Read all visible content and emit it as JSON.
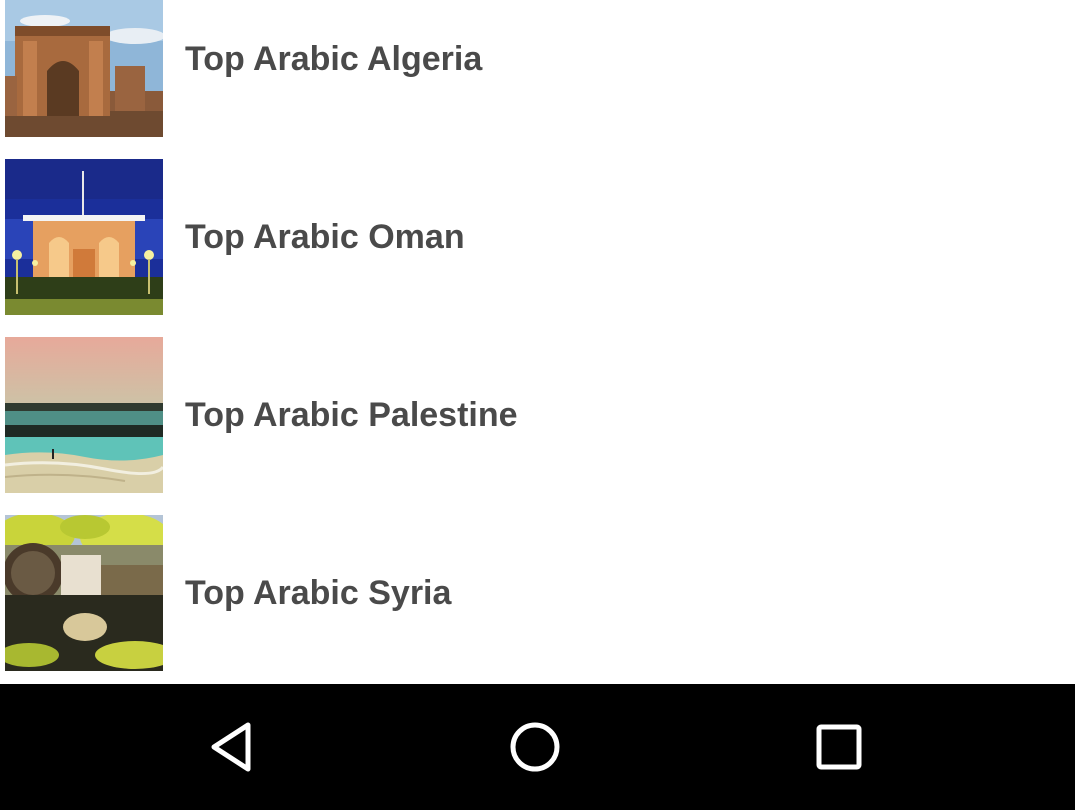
{
  "list": {
    "items": [
      {
        "label": "Top Arabic Algeria",
        "image": "roman-arch-ruins-photo"
      },
      {
        "label": "Top Arabic Oman",
        "image": "palace-night-photo"
      },
      {
        "label": "Top Arabic Palestine",
        "image": "beach-shore-photo"
      },
      {
        "label": "Top Arabic Syria",
        "image": "water-wheel-photo"
      }
    ]
  },
  "nav_bar": {
    "buttons": [
      "back-icon",
      "home-icon",
      "recents-icon"
    ],
    "background": "#000000"
  },
  "colors": {
    "label_text": "#4a4a4a",
    "background": "#ffffff"
  }
}
